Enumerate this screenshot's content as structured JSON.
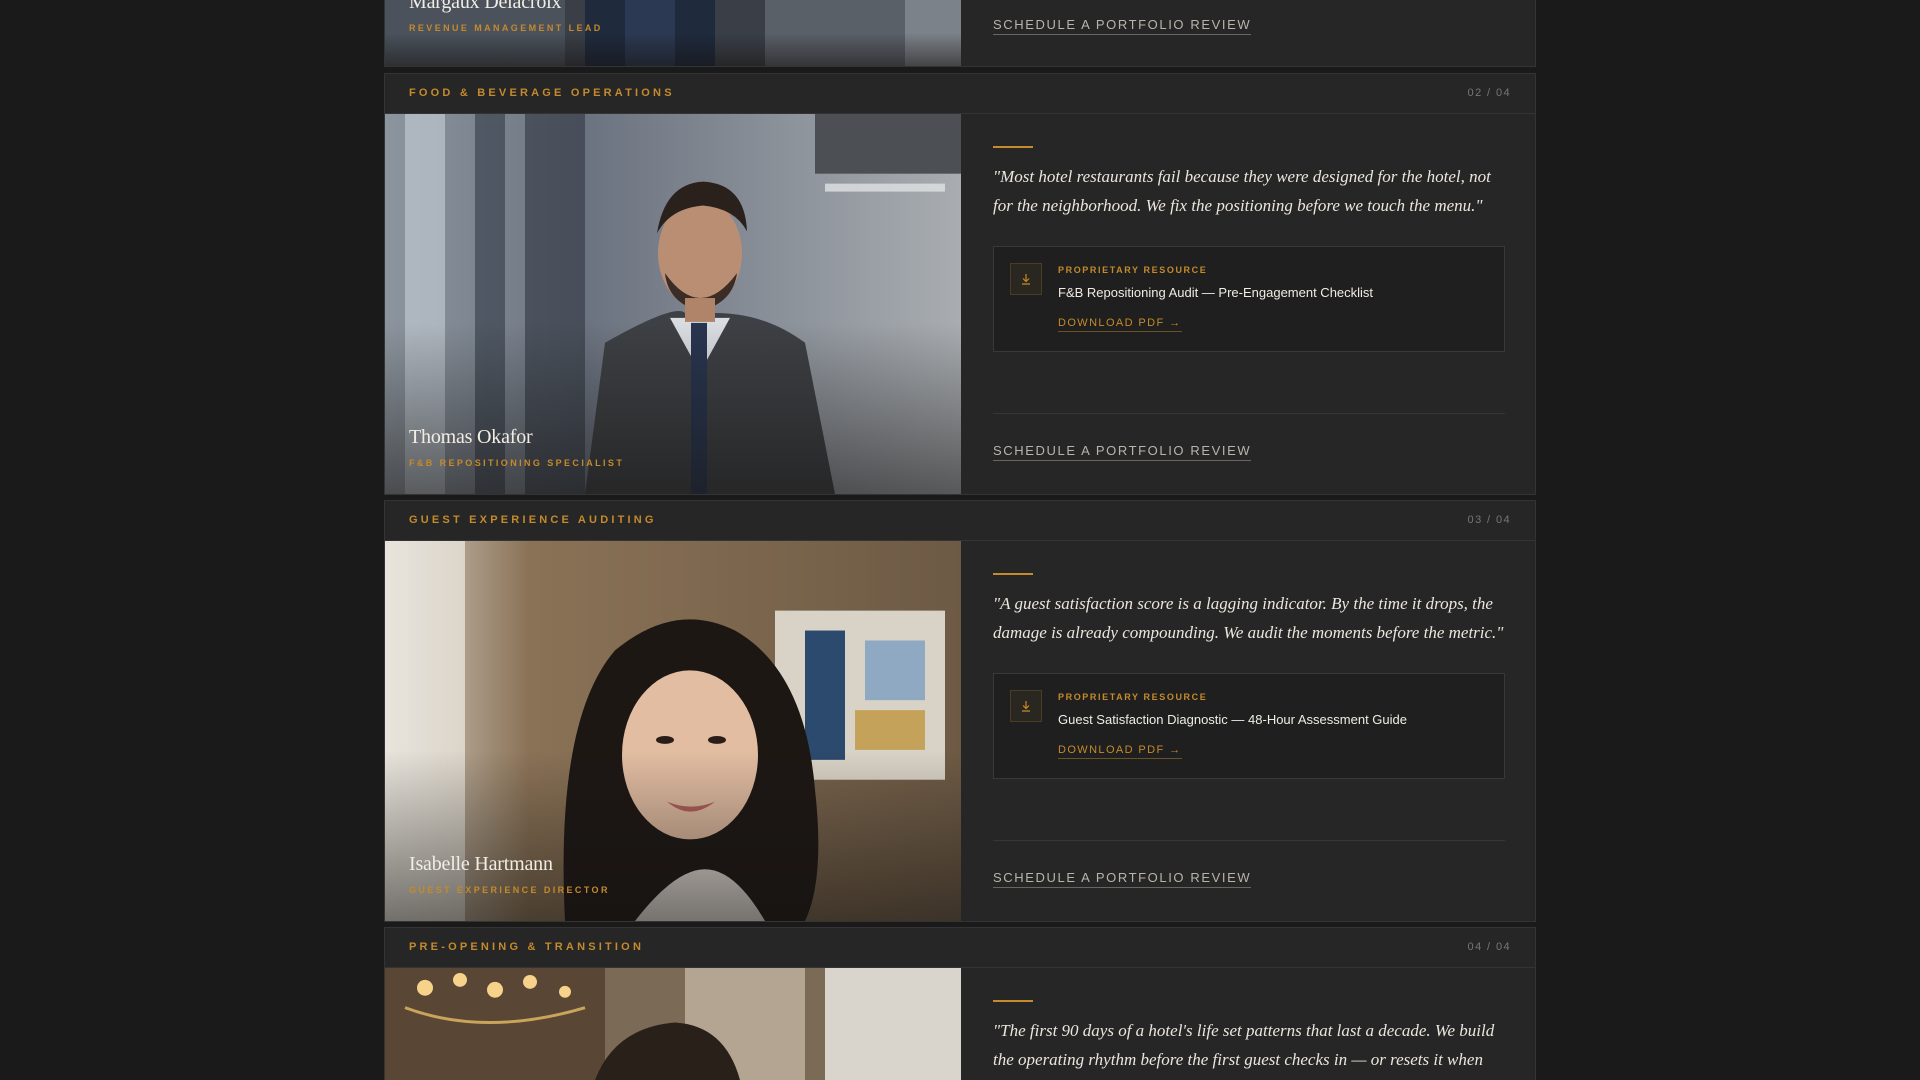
{
  "cards": [
    {
      "person_name": "Margaux Delacroix",
      "person_role": "REVENUE MANAGEMENT LEAD",
      "cta": "SCHEDULE A PORTFOLIO REVIEW"
    },
    {
      "section_title": "FOOD & BEVERAGE OPERATIONS",
      "counter": "02 / 04",
      "person_name": "Thomas Okafor",
      "person_role": "F&B REPOSITIONING SPECIALIST",
      "quote": "\"Most hotel restaurants fail because they were designed for the hotel, not for the neighborhood. We fix the positioning before we touch the menu.\"",
      "resource_kicker": "PROPRIETARY RESOURCE",
      "resource_title": "F&B Repositioning Audit — Pre-Engagement Checklist",
      "resource_link": "DOWNLOAD PDF →",
      "cta": "SCHEDULE A PORTFOLIO REVIEW"
    },
    {
      "section_title": "GUEST EXPERIENCE AUDITING",
      "counter": "03 / 04",
      "person_name": "Isabelle Hartmann",
      "person_role": "GUEST EXPERIENCE DIRECTOR",
      "quote": "\"A guest satisfaction score is a lagging indicator. By the time it drops, the damage is already compounding. We audit the moments before the metric.\"",
      "resource_kicker": "PROPRIETARY RESOURCE",
      "resource_title": "Guest Satisfaction Diagnostic — 48-Hour Assessment Guide",
      "resource_link": "DOWNLOAD PDF →",
      "cta": "SCHEDULE A PORTFOLIO REVIEW"
    },
    {
      "section_title": "PRE-OPENING & TRANSITION",
      "counter": "04 / 04",
      "quote": "\"The first 90 days of a hotel's life set patterns that last a decade. We build the operating rhythm before the first guest checks in — or resets it when"
    }
  ],
  "icons": {
    "download": "download-icon"
  },
  "colors": {
    "accent": "#c48a2c",
    "background": "#1a1a1b",
    "card": "#262626"
  }
}
